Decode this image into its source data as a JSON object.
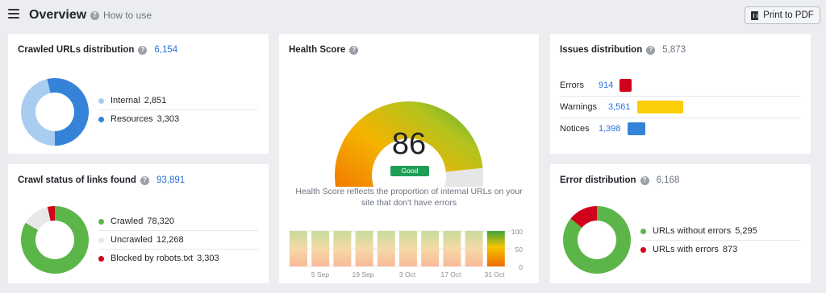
{
  "header": {
    "title": "Overview",
    "how_to_use": "How to use",
    "print_button": "Print to PDF"
  },
  "crawled_urls": {
    "title": "Crawled URLs distribution",
    "total": "6,154",
    "items": [
      {
        "label": "Internal",
        "value": "2,851",
        "count": 2851,
        "color": "#a8cdf0"
      },
      {
        "label": "Resources",
        "value": "3,303",
        "count": 3303,
        "color": "#3583d9"
      }
    ]
  },
  "health_score": {
    "title": "Health Score",
    "score": "86",
    "score_value": 86,
    "status": "Good",
    "description_line1": "Health Score reflects the proportion of internal URLs on your",
    "description_line2": "site that don't have errors",
    "trend_labels": [
      "5 Sep",
      "19 Sep",
      "3 Oct",
      "17 Oct",
      "31 Oct"
    ],
    "axis_labels": [
      "100",
      "50",
      "0"
    ]
  },
  "issues_distribution": {
    "title": "Issues distribution",
    "total": "5,873",
    "items": [
      {
        "label": "Errors",
        "value": "914",
        "count": 914,
        "color": "#d0021b"
      },
      {
        "label": "Warnings",
        "value": "3,561",
        "count": 3561,
        "color": "#fcce0a"
      },
      {
        "label": "Notices",
        "value": "1,398",
        "count": 1398,
        "color": "#3583d9"
      }
    ]
  },
  "crawl_status": {
    "title": "Crawl status of links found",
    "total": "93,891",
    "items": [
      {
        "label": "Crawled",
        "value": "78,320",
        "count": 78320,
        "color": "#5cb548"
      },
      {
        "label": "Uncrawled",
        "value": "12,268",
        "count": 12268,
        "color": "#e8e8e8"
      },
      {
        "label": "Blocked by robots.txt",
        "value": "3,303",
        "count": 3303,
        "color": "#d0021b"
      }
    ]
  },
  "error_distribution": {
    "title": "Error distribution",
    "total": "6,168",
    "items": [
      {
        "label": "URLs without errors",
        "value": "5,295",
        "count": 5295,
        "color": "#5cb548"
      },
      {
        "label": "URLs with errors",
        "value": "873",
        "count": 873,
        "color": "#d0021b"
      }
    ]
  }
}
